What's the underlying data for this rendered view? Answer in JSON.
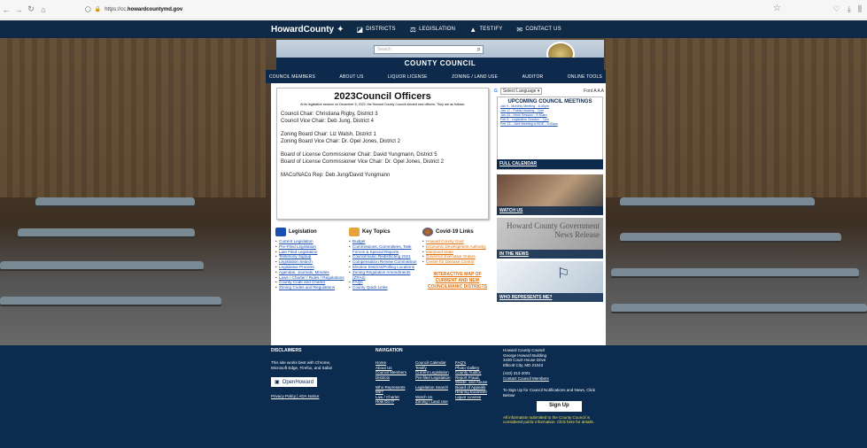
{
  "browser": {
    "url_prefix": "https://cc.",
    "url_domain": "howardcountymd.gov"
  },
  "topnav": {
    "logo": "HowardCounty",
    "items": [
      "DISTRICTS",
      "LEGISLATION",
      "TESTIFY",
      "CONTACT US"
    ]
  },
  "header": {
    "search_placeholder": "Search",
    "title": "COUNTY COUNCIL"
  },
  "menu": [
    "COUNCIL MEMBERS",
    "ABOUT US",
    "LIQUOR LICENSE",
    "ZONING / LAND USE",
    "AUDITOR",
    "ONLINE TOOLS"
  ],
  "officers": {
    "title": "2023Council Officers",
    "intro": "At its legislative session on December 5, 2022, the Howard County Council elected new officers. They are as follows:",
    "lines": [
      "Council Chair: Christiana Rigby, District 3",
      "Council Vice Chair: Deb Jung, District 4",
      "Zoning Board Chair: Liz Walsh, District 1",
      "Zoning Board Vice Chair: Dr. Opel Jones, District 2",
      "Board of License Commissioner Chair: David Yungmann, District 5",
      "Board of License Commissioner Vice Chair: Dr. Opel Jones, District 2",
      "MACo/NACo Rep: Deb Jung/David Yungmann"
    ]
  },
  "language": {
    "label": "Select Language",
    "font": "Font"
  },
  "meetings": {
    "title": "UPCOMING COUNCIL MEETINGS",
    "items": [
      "Jan 9 - Monthly Meeting - 6:30pm",
      "Jan 17 - Public Hearing - 7pm",
      "Jan 23 - Work Session - 9:30am",
      "Feb 6 - Legislative Session - 7pm",
      "Feb 13 - Joint Meeting w BOE - 9:30am"
    ],
    "full_calendar": "FULL CALENDAR"
  },
  "panels": {
    "watch": "WATCH US",
    "news": "IN THE NEWS",
    "news_art": "Howard County Government News Release",
    "represents": "WHO REPRESENTS ME?"
  },
  "columns": {
    "legislation": {
      "title": "Legislation",
      "items": [
        "Current Legislation",
        "Pre-Filed Legislation",
        "Late Filed Legislation",
        "Testimony Signup",
        "Legislation Search",
        "Legislative Process",
        "Agendas, Journals, Minutes",
        "Laws / Charter / Rules / Regulations",
        "County Code and Charter",
        "Zoning Codes and Regulations"
      ]
    },
    "topics": {
      "title": "Key Topics",
      "items": [
        "Budget",
        "Commissions, Committees, Task Forces & Special Reports",
        "Councilmanic Redistricting 2021",
        "Compensation Review Commission",
        "Election Districts/Polling Locations",
        "Zoning Regulation Amendments (ZRAs)",
        "FAQs",
        "County Quick Links"
      ]
    },
    "covid": {
      "title": "Covid-19 Links",
      "items": [
        "Howard County Govt",
        "Economic Development Authority",
        "Maryland State",
        "Governor Executive Orders",
        "Centre for Disease Control"
      ],
      "map_link": "INTERACTIVE MAP OF CURRENT AND NEW COUNCILMANIC DISTRICTS"
    }
  },
  "footer": {
    "disclaimers_title": "DISCLAIMERS",
    "disclaimers_text": "This site works best with Chrome, Microsoft Edge, Firefox, and Safari",
    "openhoward": "OpenHoward",
    "privacy": "Privacy Policy | ADA Notice",
    "navigation_title": "NAVIGATION",
    "nav": [
      "Home",
      "Council Calendar",
      "FAQ's",
      "About Us",
      "Testify",
      "Photo Gallery",
      "Council Members",
      "Current Legislation",
      "County Auditor",
      "Districts",
      "Pre-filed Legislation",
      "Report Fraud, Waste, and Abuse",
      "Who Represents Me?",
      "Legislation Search",
      "Board of Appeals Hearing Examiner",
      "Law / Charter",
      "Watch Us",
      "Liquor License",
      "How Do I?",
      "Zoning / Land Use"
    ],
    "address": [
      "Howard County Council",
      "George Howard Building",
      "3430 Court House Drive",
      "Ellicott City, MD 21043",
      "(410) 313-2001",
      "Contact Council Members"
    ],
    "signup_text": "To Sign Up for Council Notifications and News, Click Below!",
    "signup": "Sign Up",
    "disclosure": "All information submitted to the County Council is considered public information. Click here for details."
  }
}
